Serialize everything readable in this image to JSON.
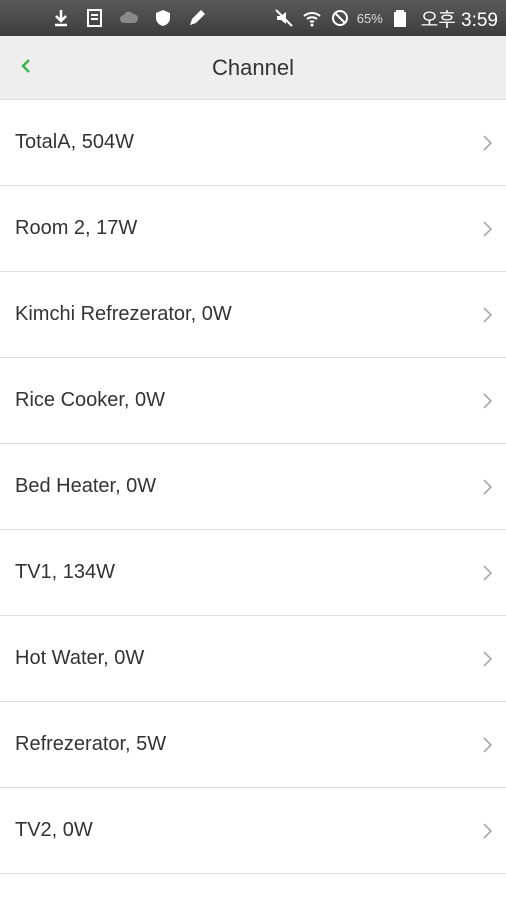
{
  "status_bar": {
    "battery_percent": "65%",
    "time": "오후 3:59"
  },
  "header": {
    "title": "Channel"
  },
  "channels": [
    {
      "label": "TotalA,  504W"
    },
    {
      "label": "Room 2,  17W"
    },
    {
      "label": "Kimchi Refrezerator,  0W"
    },
    {
      "label": "Rice Cooker,  0W"
    },
    {
      "label": "Bed Heater,  0W"
    },
    {
      "label": "TV1,  134W"
    },
    {
      "label": "Hot Water,  0W"
    },
    {
      "label": "Refrezerator,  5W"
    },
    {
      "label": "TV2,  0W"
    }
  ],
  "colors": {
    "accent": "#3cb44a",
    "status_bar": "#4a4a4a",
    "header_bg": "#eeeeee",
    "divider": "#dcdcdc"
  }
}
